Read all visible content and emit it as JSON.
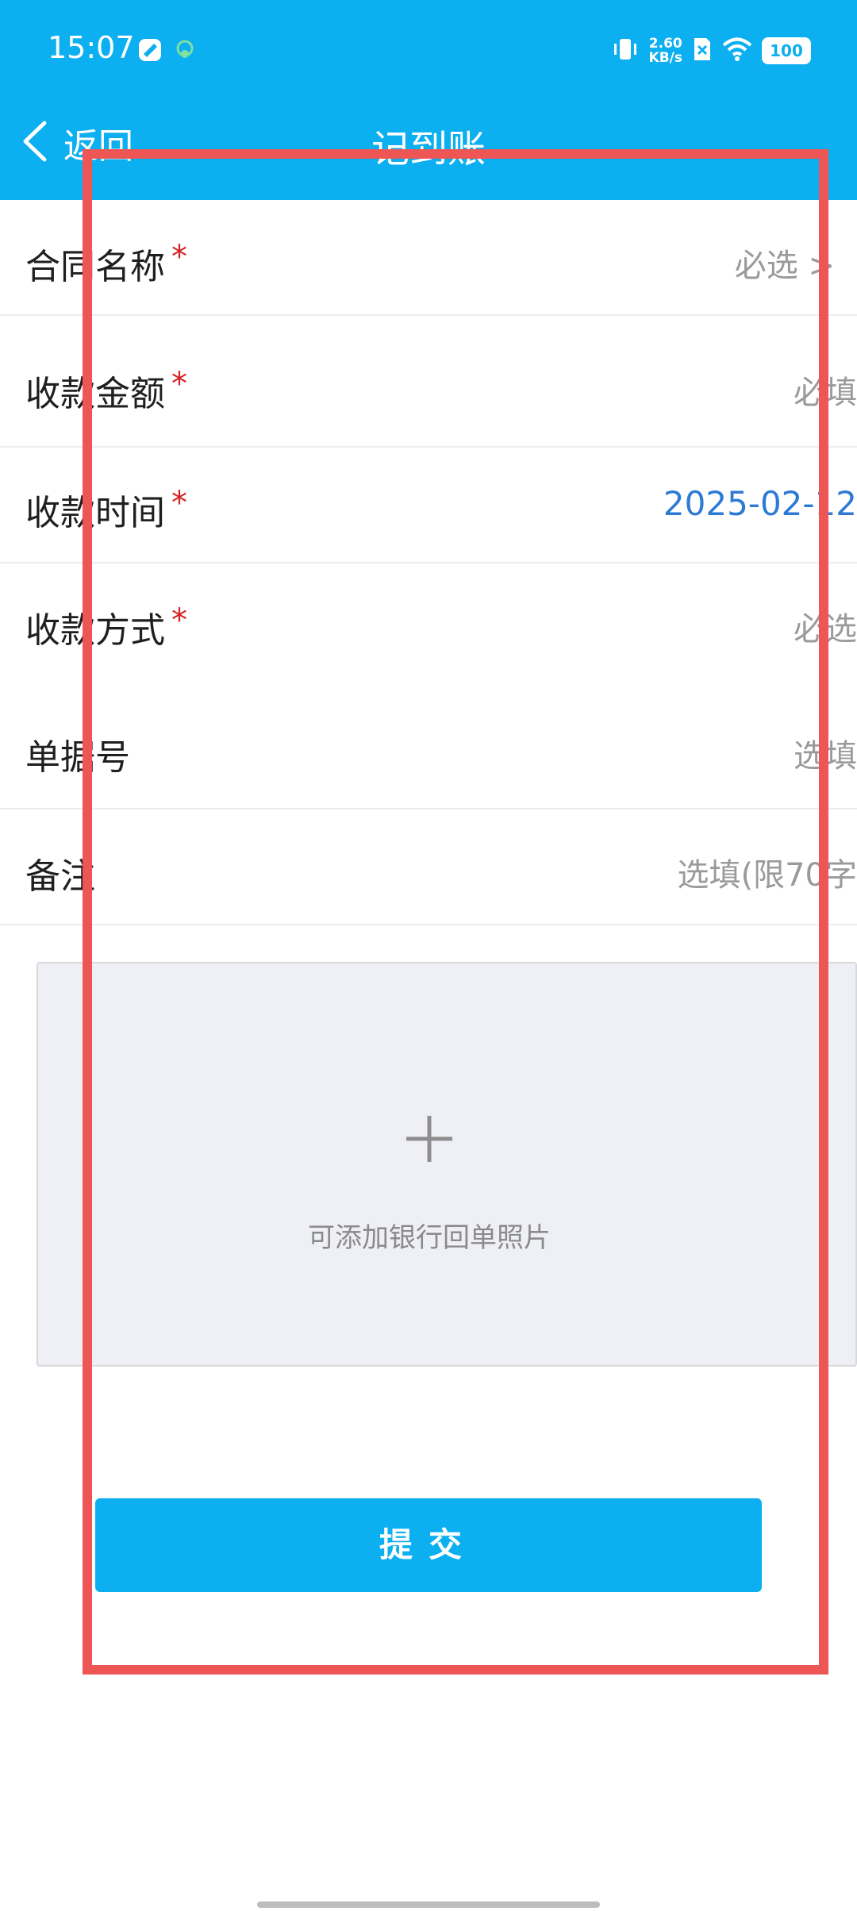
{
  "status_bar": {
    "time": "15:07",
    "net_speed_value": "2.60",
    "net_speed_unit": "KB/s",
    "battery": "100"
  },
  "nav": {
    "back_label": "返回",
    "title": "记到账"
  },
  "form": {
    "contract": {
      "label": "合同名称",
      "required_mark": "*",
      "value": "必选 >"
    },
    "amount": {
      "label": "收款金额",
      "required_mark": "*",
      "value": "必填"
    },
    "time": {
      "label": "收款时间",
      "required_mark": "*",
      "value": "2025-02-12"
    },
    "method": {
      "label": "收款方式",
      "required_mark": "*",
      "value": "必选"
    },
    "receipt_no": {
      "label": "单据号",
      "value": "选填"
    },
    "remark": {
      "label": "备注",
      "value": "选填(限70字"
    }
  },
  "upload": {
    "hint": "可添加银行回单照片"
  },
  "submit": {
    "label": "提交"
  },
  "colors": {
    "primary": "#0caff0",
    "required": "#d42020",
    "date_value": "#2d7ad6",
    "highlight": "#ee5555"
  }
}
